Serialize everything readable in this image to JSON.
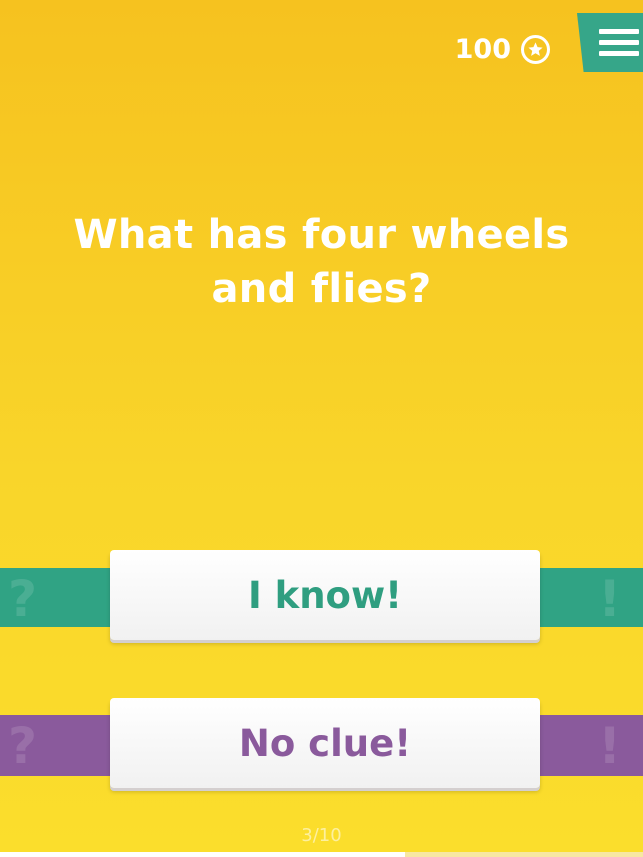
{
  "score": {
    "value": "100",
    "icon": "star-icon"
  },
  "menu": {
    "icon": "hamburger-icon",
    "color": "#36a689"
  },
  "question": {
    "text": "What has four wheels and flies?"
  },
  "answers": {
    "know_label": "I know!",
    "clue_label": "No clue!",
    "know_color": "#2f9e80",
    "clue_color": "#8a5a9c"
  },
  "band_glyphs": {
    "left": "?",
    "right": "!"
  },
  "progress": {
    "label": "3/10",
    "current": 3,
    "total": 10,
    "fraction": 0.63
  },
  "colors": {
    "background_top": "#f6c21f",
    "background_bottom": "#fbde2c",
    "teal_band": "#30a384",
    "purple_band": "#8a5a9c"
  }
}
